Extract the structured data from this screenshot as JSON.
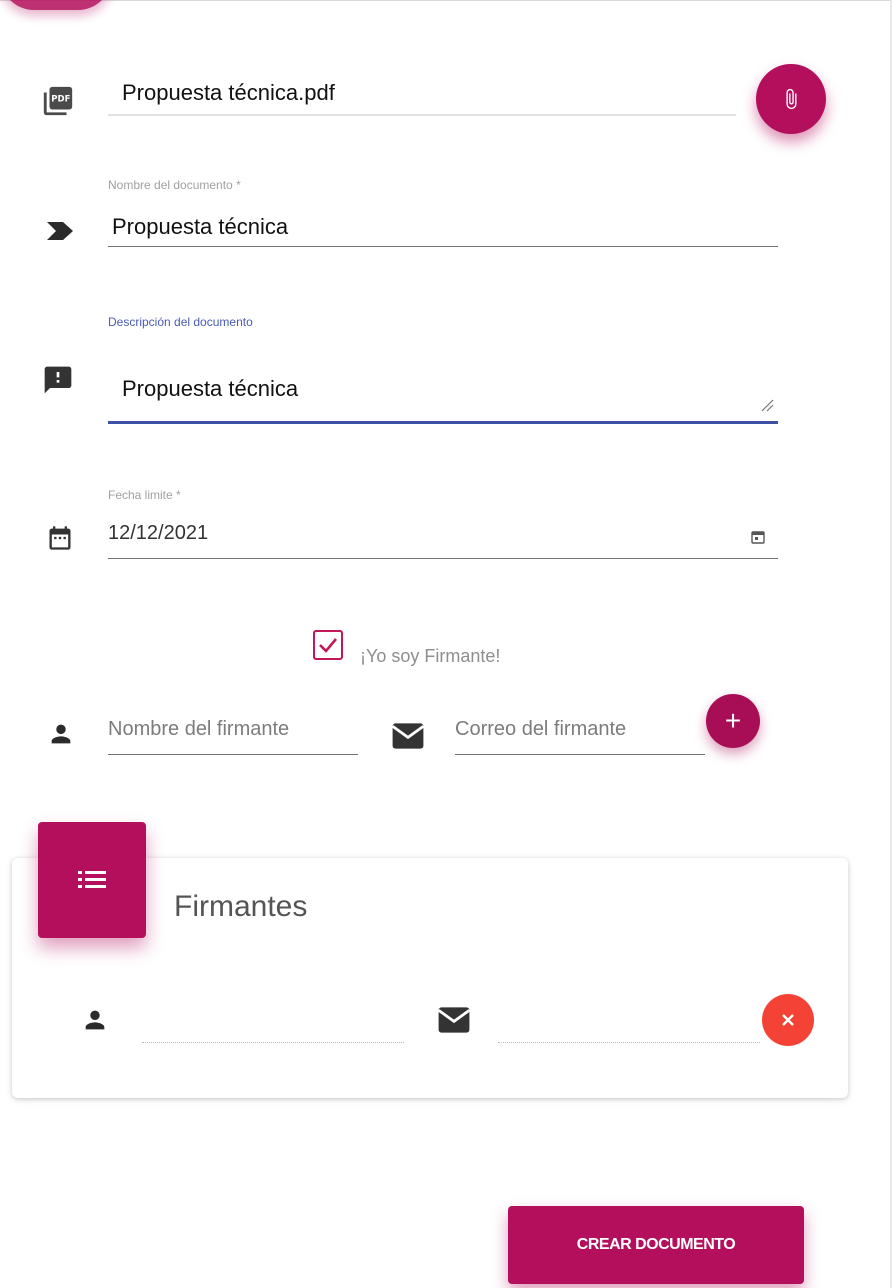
{
  "file": {
    "name": "Propuesta técnica.pdf",
    "attach_icon": "paperclip-icon",
    "file_icon": "pdf-icon"
  },
  "document_name": {
    "label": "Nombre del documento *",
    "value": "Propuesta técnica",
    "icon": "label-icon"
  },
  "description": {
    "label": "Descripción del documento",
    "value": "Propuesta técnica",
    "icon": "feedback-icon"
  },
  "deadline": {
    "label": "Fecha limite *",
    "value": "12/12/2021",
    "icon": "calendar-icon"
  },
  "signer_checkbox": {
    "label": "¡Yo soy Firmante!",
    "checked": true
  },
  "new_signer": {
    "name_placeholder": "Nombre del firmante",
    "email_placeholder": "Correo del firmante",
    "add_label": "+"
  },
  "signers_card": {
    "title": "Firmantes",
    "rows": [
      {
        "name": "",
        "email": ""
      }
    ]
  },
  "create_button": {
    "label": "CREAR DOCUMENTO"
  },
  "colors": {
    "primary": "#b30f5c",
    "focus": "#3f51a5",
    "danger": "#f44336"
  }
}
